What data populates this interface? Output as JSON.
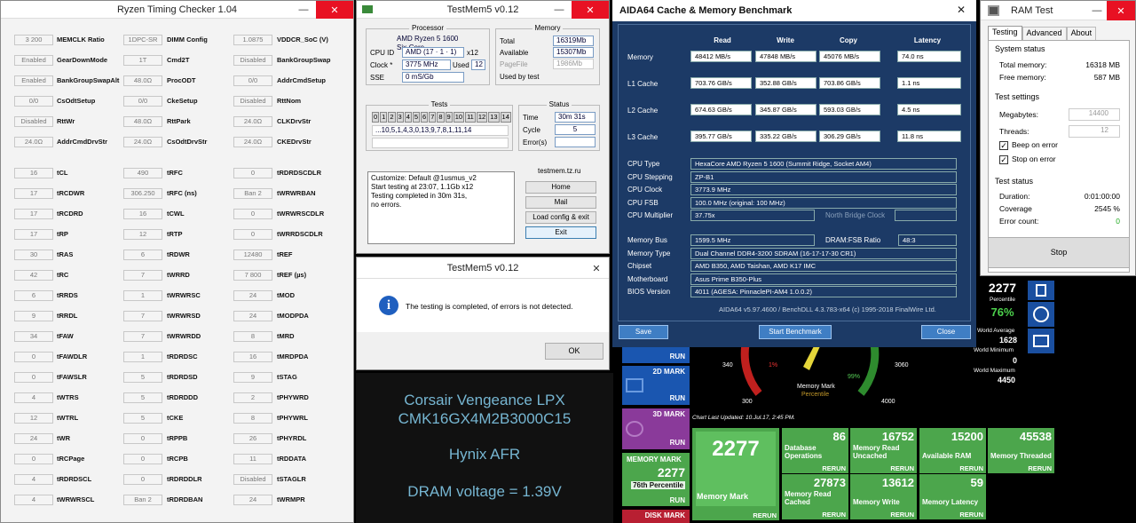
{
  "ryzen": {
    "title": "Ryzen Timing Checker 1.04",
    "col1": [
      [
        "3 200",
        "MEMCLK Ratio"
      ],
      [
        "Enabled",
        "GearDownMode"
      ],
      [
        "Enabled",
        "BankGroupSwapAlt"
      ],
      [
        "0/0",
        "CsOdtSetup"
      ],
      [
        "Disabled",
        "RttWr"
      ],
      [
        "24.0Ω",
        "AddrCmdDrvStr"
      ],
      [
        "16",
        "tCL"
      ],
      [
        "17",
        "tRCDWR"
      ],
      [
        "17",
        "tRCDRD"
      ],
      [
        "17",
        "tRP"
      ],
      [
        "30",
        "tRAS"
      ],
      [
        "42",
        "tRC"
      ],
      [
        "6",
        "tRRDS"
      ],
      [
        "9",
        "tRRDL"
      ],
      [
        "34",
        "tFAW"
      ],
      [
        "0",
        "tFAWDLR"
      ],
      [
        "0",
        "tFAWSLR"
      ],
      [
        "4",
        "tWTRS"
      ],
      [
        "12",
        "tWTRL"
      ],
      [
        "24",
        "tWR"
      ],
      [
        "0",
        "tRCPage"
      ],
      [
        "4",
        "tRDRDSCL"
      ],
      [
        "4",
        "tWRWRSCL"
      ]
    ],
    "col2": [
      [
        "1DPC-SR",
        "DIMM Config"
      ],
      [
        "1T",
        "Cmd2T"
      ],
      [
        "48.0Ω",
        "ProcODT"
      ],
      [
        "0/0",
        "CkeSetup"
      ],
      [
        "48.0Ω",
        "RttPark"
      ],
      [
        "24.0Ω",
        "CsOdtDrvStr"
      ],
      [
        "490",
        "tRFC"
      ],
      [
        "306.250",
        "tRFC (ns)"
      ],
      [
        "16",
        "tCWL"
      ],
      [
        "12",
        "tRTP"
      ],
      [
        "6",
        "tRDWR"
      ],
      [
        "7",
        "tWRRD"
      ],
      [
        "1",
        "tWRWRSC"
      ],
      [
        "7",
        "tWRWRSD"
      ],
      [
        "7",
        "tWRWRDD"
      ],
      [
        "1",
        "tRDRDSC"
      ],
      [
        "5",
        "tRDRDSD"
      ],
      [
        "5",
        "tRDRDDD"
      ],
      [
        "5",
        "tCKE"
      ],
      [
        "0",
        "tRPPB"
      ],
      [
        "0",
        "tRCPB"
      ],
      [
        "0",
        "tRDRDDLR"
      ],
      [
        "Ban 2",
        "tRDRDBAN"
      ]
    ],
    "col3": [
      [
        "1.0875",
        "VDDCR_SoC (V)"
      ],
      [
        "Disabled",
        "BankGroupSwap"
      ],
      [
        "0/0",
        "AddrCmdSetup"
      ],
      [
        "Disabled",
        "RttNom"
      ],
      [
        "24.0Ω",
        "CLKDrvStr"
      ],
      [
        "24.0Ω",
        "CKEDrvStr"
      ],
      [
        "0",
        "tRDRDSCDLR"
      ],
      [
        "Ban 2",
        "tWRWRBAN"
      ],
      [
        "0",
        "tWRWRSCDLR"
      ],
      [
        "0",
        "tWRRDSCDLR"
      ],
      [
        "12480",
        "tREF"
      ],
      [
        "7 800",
        "tREF (µs)"
      ],
      [
        "24",
        "tMOD"
      ],
      [
        "24",
        "tMODPDA"
      ],
      [
        "8",
        "tMRD"
      ],
      [
        "16",
        "tMRDPDA"
      ],
      [
        "9",
        "tSTAG"
      ],
      [
        "2",
        "tPHYWRD"
      ],
      [
        "8",
        "tPHYWRL"
      ],
      [
        "26",
        "tPHYRDL"
      ],
      [
        "11",
        "tRDDATA"
      ],
      [
        "Disabled",
        "tSTAGLR"
      ],
      [
        "24",
        "tWRMPR"
      ]
    ]
  },
  "tm1": {
    "title": "TestMem5 v0.12",
    "proc_group": "Processor",
    "cpu_id_label": "CPU ID",
    "cpu_name": "AMD Ryzen 5 1600 Six-Core",
    "cpu_id": "AMD (17 · 1 · 1)",
    "cpu_id_x": "x12",
    "clock_label": "Clock *",
    "clock": "3775 MHz",
    "used_label": "Used",
    "used": "12",
    "sse_label": "SSE",
    "sse": "0 mS/Gb",
    "mem_group": "Memory",
    "total_label": "Total",
    "total": "16319Mb",
    "avail_label": "Available",
    "avail": "15307Mb",
    "pagefile_label": "PageFile",
    "pagefile": "1986Mb",
    "usedby_label": "Used by test",
    "tests_group": "Tests",
    "tests": [
      "0",
      "1",
      "2",
      "3",
      "4",
      "5",
      "6",
      "7",
      "8",
      "9",
      "10",
      "11",
      "12",
      "13",
      "14"
    ],
    "seq": "...10,5,1,4,3,0,13,9,7,8,1,11,14",
    "status_group": "Status",
    "time_label": "Time",
    "time": "30m 31s",
    "cycle_label": "Cycle",
    "cycle": "5",
    "errors_label": "Error(s)",
    "log": [
      "Customize: Default @1usmus_v2",
      "Start testing at 23:07, 1.1Gb x12",
      "Testing completed in 30m 31s,",
      "no errors."
    ],
    "site": "testmem.tz.ru",
    "btn_home": "Home",
    "btn_mail": "Mail",
    "btn_load": "Load config & exit",
    "btn_exit": "Exit"
  },
  "tm2": {
    "title": "TestMem5 v0.12",
    "message": "The testing is completed, of errors is not detected.",
    "ok": "OK"
  },
  "ram": {
    "name": "Corsair Vengeance LPX",
    "model": "CMK16GX4M2B3000C15",
    "ic": "Hynix AFR",
    "voltage": "DRAM voltage = 1.39V"
  },
  "aida": {
    "title": "AIDA64 Cache & Memory Benchmark",
    "headers": [
      "Read",
      "Write",
      "Copy",
      "Latency"
    ],
    "rows": [
      [
        "Memory",
        "48412 MB/s",
        "47848 MB/s",
        "45076 MB/s",
        "74.0 ns"
      ],
      [
        "L1 Cache",
        "703.76 GB/s",
        "352.88 GB/s",
        "703.86 GB/s",
        "1.1 ns"
      ],
      [
        "L2 Cache",
        "674.63 GB/s",
        "345.87 GB/s",
        "593.03 GB/s",
        "4.5 ns"
      ],
      [
        "L3 Cache",
        "395.77 GB/s",
        "335.22 GB/s",
        "306.29 GB/s",
        "11.8 ns"
      ]
    ],
    "cpu_type_l": "CPU Type",
    "cpu_type": "HexaCore AMD Ryzen 5 1600  (Summit Ridge, Socket AM4)",
    "cpu_step_l": "CPU Stepping",
    "cpu_step": "ZP-B1",
    "cpu_clock_l": "CPU Clock",
    "cpu_clock": "3773.9 MHz",
    "cpu_fsb_l": "CPU FSB",
    "cpu_fsb": "100.0 MHz  (original: 100 MHz)",
    "cpu_mult_l": "CPU Multiplier",
    "cpu_mult": "37.75x",
    "nb_clock": "North Bridge Clock",
    "mem_bus_l": "Memory Bus",
    "mem_bus": "1599.5 MHz",
    "dram_ratio_l": "DRAM:FSB Ratio",
    "dram_ratio": "48:3",
    "mem_type_l": "Memory Type",
    "mem_type": "Dual Channel DDR4-3200 SDRAM  (16-17-17-30 CR1)",
    "chipset_l": "Chipset",
    "chipset": "AMD B350, AMD Taishan, AMD K17 IMC",
    "mobo_l": "Motherboard",
    "mobo": "Asus Prime B350-Plus",
    "bios_l": "BIOS Version",
    "bios": "4011  (AGESA: PinnaclePI-AM4 1.0.0.2)",
    "footer": "AIDA64 v5.97.4600 / BenchDLL 4.3.783-x64  (c) 1995-2018 FinalWire Ltd.",
    "save": "Save",
    "start": "Start Benchmark",
    "close": "Close"
  },
  "ramtest": {
    "title": "RAM Test",
    "tabs": [
      "Testing",
      "Advanced",
      "About"
    ],
    "sys_status": "System status",
    "total_l": "Total memory:",
    "total": "16318 MB",
    "free_l": "Free memory:",
    "free": "587 MB",
    "settings": "Test settings",
    "mb_l": "Megabytes:",
    "mb": "14400",
    "threads_l": "Threads:",
    "threads": "12",
    "beep": "Beep on error",
    "stop_err": "Stop on error",
    "status": "Test status",
    "dur_l": "Duration:",
    "dur": "0:01:00:00",
    "cov_l": "Coverage",
    "cov": "2545 %",
    "err_l": "Error count:",
    "err": "0",
    "stop": "Stop"
  },
  "pm": {
    "score": "2277",
    "pct_label": "Percentile",
    "pct": "76%",
    "wavg_l": "World Average",
    "wavg": "1628",
    "wmin_l": "World Minimum",
    "wmin": "0",
    "wmax_l": "World Maximum",
    "wmax": "4450",
    "gauge_340": "340",
    "gauge_3060": "3060",
    "gauge_1": "1%",
    "gauge_99": "99%",
    "gauge_300": "300",
    "gauge_4000": "4000",
    "gauge_mm": "Memory Mark",
    "gauge_pc": "Percentile",
    "chart_upd": "Chart Last Updated: 10.Jul.17, 2:45 PM.",
    "run": "RUN",
    "m2d": "2D MARK",
    "m3d": "3D MARK",
    "mmem": "MEMORY MARK",
    "mem_score": "2277",
    "mem_pct": "76th Percentile",
    "mdisk": "DISK MARK",
    "big": "2277",
    "big_lbl": "Memory Mark",
    "rerun": "RERUN",
    "tiles": [
      [
        "86",
        "Database",
        "Operations"
      ],
      [
        "16752",
        "Memory Read",
        "Uncached"
      ],
      [
        "15200",
        "Available RAM",
        ""
      ],
      [
        "45538",
        "Memory Threaded",
        ""
      ],
      [
        "27873",
        "Memory Read",
        "Cached"
      ],
      [
        "13612",
        "Memory Write",
        ""
      ],
      [
        "59",
        "Memory Latency",
        ""
      ]
    ]
  }
}
